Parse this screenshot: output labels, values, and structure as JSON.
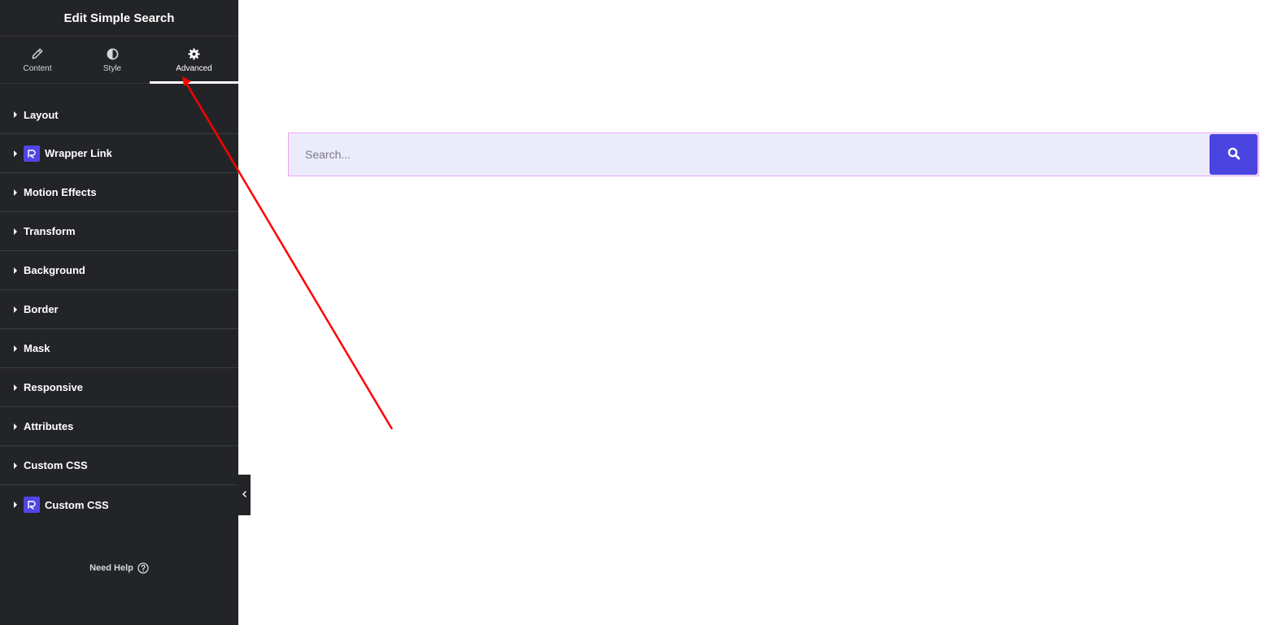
{
  "panel": {
    "title": "Edit Simple Search",
    "tabs": [
      {
        "label": "Content",
        "icon": "pencil-icon"
      },
      {
        "label": "Style",
        "icon": "half-circle-icon"
      },
      {
        "label": "Advanced",
        "icon": "gear-icon",
        "active": true
      }
    ],
    "sections": [
      {
        "label": "Layout"
      },
      {
        "label": "Wrapper Link",
        "badge": "plugin-logo-icon"
      },
      {
        "label": "Motion Effects"
      },
      {
        "label": "Transform"
      },
      {
        "label": "Background"
      },
      {
        "label": "Border"
      },
      {
        "label": "Mask"
      },
      {
        "label": "Responsive"
      },
      {
        "label": "Attributes"
      },
      {
        "label": "Custom CSS"
      },
      {
        "label": "Custom CSS",
        "badge": "plugin-logo-icon"
      }
    ],
    "help_label": "Need Help"
  },
  "search": {
    "placeholder": "Search...",
    "button_icon": "search-icon"
  },
  "colors": {
    "panel_bg": "#232427",
    "accent": "#4a44e0",
    "input_bg": "#ecebfb",
    "input_border": "#e8a7f2",
    "annotation": "#ff0000"
  }
}
